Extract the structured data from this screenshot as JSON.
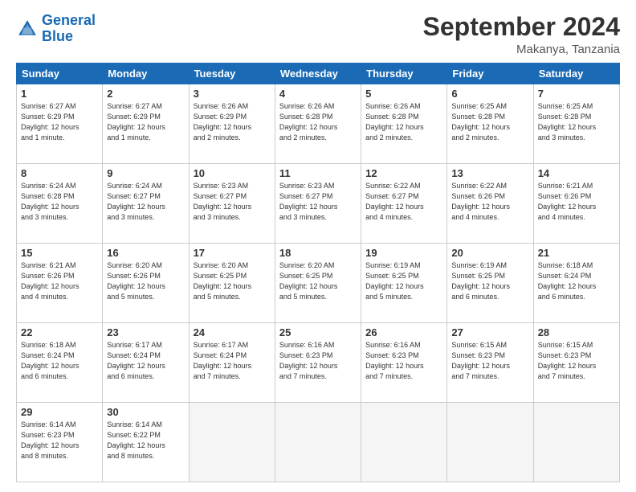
{
  "logo": {
    "line1": "General",
    "line2": "Blue"
  },
  "title": "September 2024",
  "location": "Makanya, Tanzania",
  "days_of_week": [
    "Sunday",
    "Monday",
    "Tuesday",
    "Wednesday",
    "Thursday",
    "Friday",
    "Saturday"
  ],
  "weeks": [
    [
      {
        "num": "1",
        "info": "Sunrise: 6:27 AM\nSunset: 6:29 PM\nDaylight: 12 hours\nand 1 minute."
      },
      {
        "num": "2",
        "info": "Sunrise: 6:27 AM\nSunset: 6:29 PM\nDaylight: 12 hours\nand 1 minute."
      },
      {
        "num": "3",
        "info": "Sunrise: 6:26 AM\nSunset: 6:29 PM\nDaylight: 12 hours\nand 2 minutes."
      },
      {
        "num": "4",
        "info": "Sunrise: 6:26 AM\nSunset: 6:28 PM\nDaylight: 12 hours\nand 2 minutes."
      },
      {
        "num": "5",
        "info": "Sunrise: 6:26 AM\nSunset: 6:28 PM\nDaylight: 12 hours\nand 2 minutes."
      },
      {
        "num": "6",
        "info": "Sunrise: 6:25 AM\nSunset: 6:28 PM\nDaylight: 12 hours\nand 2 minutes."
      },
      {
        "num": "7",
        "info": "Sunrise: 6:25 AM\nSunset: 6:28 PM\nDaylight: 12 hours\nand 3 minutes."
      }
    ],
    [
      {
        "num": "8",
        "info": "Sunrise: 6:24 AM\nSunset: 6:28 PM\nDaylight: 12 hours\nand 3 minutes."
      },
      {
        "num": "9",
        "info": "Sunrise: 6:24 AM\nSunset: 6:27 PM\nDaylight: 12 hours\nand 3 minutes."
      },
      {
        "num": "10",
        "info": "Sunrise: 6:23 AM\nSunset: 6:27 PM\nDaylight: 12 hours\nand 3 minutes."
      },
      {
        "num": "11",
        "info": "Sunrise: 6:23 AM\nSunset: 6:27 PM\nDaylight: 12 hours\nand 3 minutes."
      },
      {
        "num": "12",
        "info": "Sunrise: 6:22 AM\nSunset: 6:27 PM\nDaylight: 12 hours\nand 4 minutes."
      },
      {
        "num": "13",
        "info": "Sunrise: 6:22 AM\nSunset: 6:26 PM\nDaylight: 12 hours\nand 4 minutes."
      },
      {
        "num": "14",
        "info": "Sunrise: 6:21 AM\nSunset: 6:26 PM\nDaylight: 12 hours\nand 4 minutes."
      }
    ],
    [
      {
        "num": "15",
        "info": "Sunrise: 6:21 AM\nSunset: 6:26 PM\nDaylight: 12 hours\nand 4 minutes."
      },
      {
        "num": "16",
        "info": "Sunrise: 6:20 AM\nSunset: 6:26 PM\nDaylight: 12 hours\nand 5 minutes."
      },
      {
        "num": "17",
        "info": "Sunrise: 6:20 AM\nSunset: 6:25 PM\nDaylight: 12 hours\nand 5 minutes."
      },
      {
        "num": "18",
        "info": "Sunrise: 6:20 AM\nSunset: 6:25 PM\nDaylight: 12 hours\nand 5 minutes."
      },
      {
        "num": "19",
        "info": "Sunrise: 6:19 AM\nSunset: 6:25 PM\nDaylight: 12 hours\nand 5 minutes."
      },
      {
        "num": "20",
        "info": "Sunrise: 6:19 AM\nSunset: 6:25 PM\nDaylight: 12 hours\nand 6 minutes."
      },
      {
        "num": "21",
        "info": "Sunrise: 6:18 AM\nSunset: 6:24 PM\nDaylight: 12 hours\nand 6 minutes."
      }
    ],
    [
      {
        "num": "22",
        "info": "Sunrise: 6:18 AM\nSunset: 6:24 PM\nDaylight: 12 hours\nand 6 minutes."
      },
      {
        "num": "23",
        "info": "Sunrise: 6:17 AM\nSunset: 6:24 PM\nDaylight: 12 hours\nand 6 minutes."
      },
      {
        "num": "24",
        "info": "Sunrise: 6:17 AM\nSunset: 6:24 PM\nDaylight: 12 hours\nand 7 minutes."
      },
      {
        "num": "25",
        "info": "Sunrise: 6:16 AM\nSunset: 6:23 PM\nDaylight: 12 hours\nand 7 minutes."
      },
      {
        "num": "26",
        "info": "Sunrise: 6:16 AM\nSunset: 6:23 PM\nDaylight: 12 hours\nand 7 minutes."
      },
      {
        "num": "27",
        "info": "Sunrise: 6:15 AM\nSunset: 6:23 PM\nDaylight: 12 hours\nand 7 minutes."
      },
      {
        "num": "28",
        "info": "Sunrise: 6:15 AM\nSunset: 6:23 PM\nDaylight: 12 hours\nand 7 minutes."
      }
    ],
    [
      {
        "num": "29",
        "info": "Sunrise: 6:14 AM\nSunset: 6:23 PM\nDaylight: 12 hours\nand 8 minutes."
      },
      {
        "num": "30",
        "info": "Sunrise: 6:14 AM\nSunset: 6:22 PM\nDaylight: 12 hours\nand 8 minutes."
      },
      {
        "num": "",
        "info": ""
      },
      {
        "num": "",
        "info": ""
      },
      {
        "num": "",
        "info": ""
      },
      {
        "num": "",
        "info": ""
      },
      {
        "num": "",
        "info": ""
      }
    ]
  ]
}
